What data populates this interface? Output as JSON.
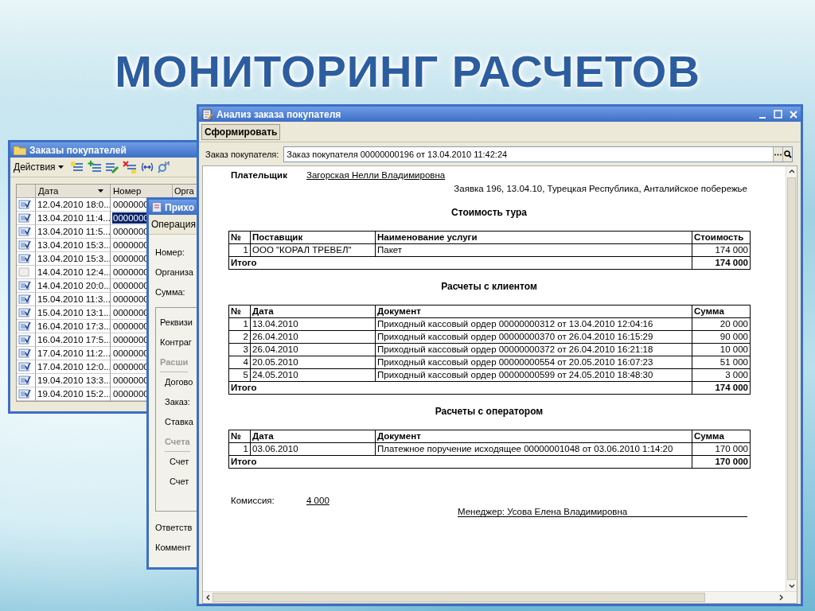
{
  "slide_title": "МОНИТОРИНГ РАСЧЕТОВ",
  "orders_window": {
    "title": "Заказы покупателей",
    "actions_label": "Действия",
    "columns": [
      "Дата",
      "Номер",
      "Орга"
    ],
    "rows": [
      {
        "date": "12.04.2010 18:0...",
        "number": "0000000",
        "posted": true,
        "selected": false
      },
      {
        "date": "13.04.2010 11:4...",
        "number": "0000000",
        "posted": true,
        "selected": true
      },
      {
        "date": "13.04.2010 11:5...",
        "number": "0000000",
        "posted": true,
        "selected": false
      },
      {
        "date": "13.04.2010 15:3...",
        "number": "0000000",
        "posted": true,
        "selected": false
      },
      {
        "date": "13.04.2010 15:3...",
        "number": "0000000",
        "posted": true,
        "selected": false
      },
      {
        "date": "14.04.2010 12:4...",
        "number": "0000000",
        "posted": false,
        "selected": false
      },
      {
        "date": "14.04.2010 20:0...",
        "number": "0000000",
        "posted": true,
        "selected": false
      },
      {
        "date": "15.04.2010 11:3...",
        "number": "0000000",
        "posted": true,
        "selected": false
      },
      {
        "date": "15.04.2010 13:1...",
        "number": "0000000",
        "posted": true,
        "selected": false
      },
      {
        "date": "16.04.2010 17:3...",
        "number": "0000000",
        "posted": true,
        "selected": false
      },
      {
        "date": "16.04.2010 17:5...",
        "number": "0000000",
        "posted": true,
        "selected": false
      },
      {
        "date": "17.04.2010 11:2...",
        "number": "0000000",
        "posted": true,
        "selected": false
      },
      {
        "date": "17.04.2010 12:0...",
        "number": "0000000",
        "posted": true,
        "selected": false
      },
      {
        "date": "19.04.2010 13:3...",
        "number": "0000000",
        "posted": true,
        "selected": false
      },
      {
        "date": "19.04.2010 15:2...",
        "number": "0000000",
        "posted": true,
        "selected": false
      }
    ]
  },
  "receipt_window": {
    "title": "Прихо",
    "operation_label": "Операция",
    "fields": [
      "Номер:",
      "Организа",
      "Сумма:"
    ],
    "group": [
      {
        "kind": "field",
        "text": "Реквизи"
      },
      {
        "kind": "field",
        "text": "Контраг"
      },
      {
        "kind": "section",
        "text": "Расши",
        "children": [
          {
            "kind": "field",
            "text": "Догово"
          },
          {
            "kind": "field",
            "text": "Заказ:"
          },
          {
            "kind": "field",
            "text": "Ставка"
          },
          {
            "kind": "section",
            "text": "Счета",
            "children": [
              {
                "kind": "field",
                "text": "Счет"
              },
              {
                "kind": "field",
                "text": "Счет"
              }
            ]
          }
        ]
      }
    ],
    "footer_fields": [
      "Ответств",
      "Коммент"
    ]
  },
  "report_window": {
    "title": "Анализ заказа покупателя",
    "generate_button": "Сформировать",
    "order_label": "Заказ покупателя:",
    "order_value": "Заказ покупателя 00000000196 от 13.04.2010 11:42:24",
    "report": {
      "payer_label": "Плательщик",
      "payer": "Загорская Нелли Владимировна",
      "request": "Заявка 196, 13.04.10, Турецкая Республика, Анталийское побережье",
      "sections": [
        {
          "title": "Стоимость тура",
          "columns": [
            "№",
            "Поставщик",
            "Наименование услуги",
            "Стоимость"
          ],
          "rows": [
            [
              "1",
              "ООО \"КОРАЛ ТРЕВЕЛ\"",
              "Пакет",
              "174 000"
            ]
          ],
          "total_label": "Итого",
          "total": "174 000"
        },
        {
          "title": "Расчеты с клиентом",
          "columns": [
            "№",
            "Дата",
            "Документ",
            "Сумма"
          ],
          "rows": [
            [
              "1",
              "13.04.2010",
              "Приходный кассовый ордер 00000000312 от 13.04.2010 12:04:16",
              "20 000"
            ],
            [
              "2",
              "26.04.2010",
              "Приходный кассовый ордер 00000000370 от 26.04.2010 16:15:29",
              "90 000"
            ],
            [
              "3",
              "26.04.2010",
              "Приходный кассовый ордер 00000000372 от 26.04.2010 16:21:18",
              "10 000"
            ],
            [
              "4",
              "20.05.2010",
              "Приходный кассовый ордер 00000000554 от 20.05.2010 16:07:23",
              "51 000"
            ],
            [
              "5",
              "24.05.2010",
              "Приходный кассовый ордер 00000000599 от 24.05.2010 18:48:30",
              "3 000"
            ]
          ],
          "total_label": "Итого",
          "total": "174 000"
        },
        {
          "title": "Расчеты с оператором",
          "columns": [
            "№",
            "Дата",
            "Документ",
            "Сумма"
          ],
          "rows": [
            [
              "1",
              "03.06.2010",
              "Платежное поручение исходящее 00000001048 от 03.06.2010 1:14:20",
              "170 000"
            ]
          ],
          "total_label": "Итого",
          "total": "170 000"
        }
      ],
      "commission_label": "Комиссия:",
      "commission": "4 000",
      "manager": "Менеджер: Усова Елена Владимировна"
    }
  }
}
